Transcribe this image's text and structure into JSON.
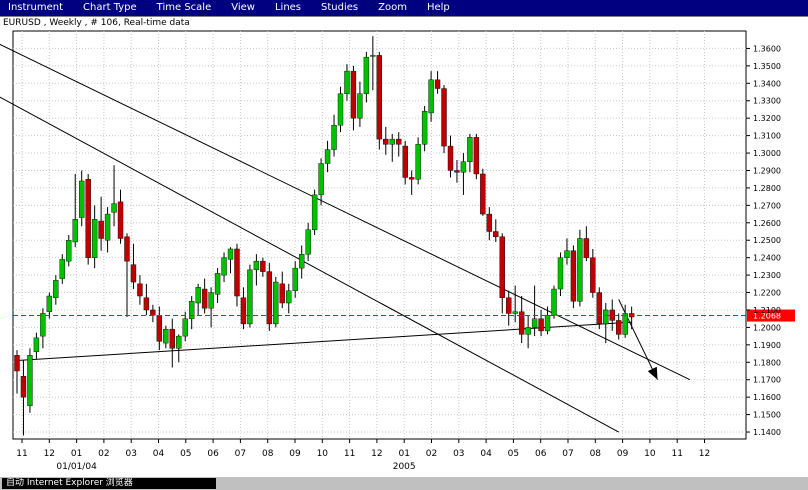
{
  "menu": {
    "items": [
      {
        "label": "Instrument"
      },
      {
        "label": "Chart Type"
      },
      {
        "label": "Time Scale"
      },
      {
        "label": "View"
      },
      {
        "label": "Lines"
      },
      {
        "label": "Studies"
      },
      {
        "label": "Zoom"
      },
      {
        "label": "Help"
      }
    ]
  },
  "chart_title": "EURUSD , Weekly , # 106, Real-time data",
  "taskbar": {
    "item_label": "自动 Internet Explorer 浏览器"
  },
  "colors": {
    "up_candle": "#00c000",
    "down_candle": "#c00000",
    "wick": "#000000",
    "grid": "#c8c8c8",
    "current_price_line": "#ff0000",
    "current_price_label_bg": "#ff0000",
    "current_price_label_text": "#ffffff",
    "trendline": "#000000",
    "menubar_bg": "#000080"
  },
  "chart_data": {
    "type": "candlestick",
    "title": "EURUSD , Weekly , # 106, Real-time data",
    "y_axis": {
      "ylim": [
        1.136,
        1.37
      ],
      "tick_labels": [
        "1.1400",
        "1.1500",
        "1.1600",
        "1.1700",
        "1.1800",
        "1.1900",
        "1.2000",
        "1.2100",
        "1.2200",
        "1.2300",
        "1.2400",
        "1.2500",
        "1.2600",
        "1.2700",
        "1.2800",
        "1.2900",
        "1.3000",
        "1.3100",
        "1.3200",
        "1.3300",
        "1.3400",
        "1.3500",
        "1.3600"
      ],
      "position": "right"
    },
    "x_axis": {
      "month_labels": [
        "11",
        "12",
        "01",
        "02",
        "03",
        "04",
        "05",
        "06",
        "07",
        "08",
        "09",
        "10",
        "11",
        "12",
        "01",
        "02",
        "03",
        "04",
        "05",
        "06",
        "07",
        "08",
        "09",
        "10",
        "11",
        "12"
      ],
      "year_labels": [
        "01/01/04",
        "2005"
      ]
    },
    "grid": true,
    "current_price": {
      "value": 1.2068,
      "label": "1.2068"
    },
    "candles": [
      {
        "o": 1.184,
        "h": 1.187,
        "l": 1.162,
        "c": 1.175
      },
      {
        "o": 1.172,
        "h": 1.181,
        "l": 1.138,
        "c": 1.16
      },
      {
        "o": 1.155,
        "h": 1.188,
        "l": 1.151,
        "c": 1.184
      },
      {
        "o": 1.186,
        "h": 1.197,
        "l": 1.182,
        "c": 1.194
      },
      {
        "o": 1.195,
        "h": 1.211,
        "l": 1.188,
        "c": 1.208
      },
      {
        "o": 1.209,
        "h": 1.22,
        "l": 1.205,
        "c": 1.218
      },
      {
        "o": 1.217,
        "h": 1.23,
        "l": 1.213,
        "c": 1.227
      },
      {
        "o": 1.228,
        "h": 1.242,
        "l": 1.225,
        "c": 1.239
      },
      {
        "o": 1.238,
        "h": 1.253,
        "l": 1.235,
        "c": 1.25
      },
      {
        "o": 1.249,
        "h": 1.288,
        "l": 1.246,
        "c": 1.262
      },
      {
        "o": 1.263,
        "h": 1.29,
        "l": 1.258,
        "c": 1.284
      },
      {
        "o": 1.285,
        "h": 1.288,
        "l": 1.236,
        "c": 1.24
      },
      {
        "o": 1.24,
        "h": 1.27,
        "l": 1.234,
        "c": 1.262
      },
      {
        "o": 1.261,
        "h": 1.275,
        "l": 1.244,
        "c": 1.251
      },
      {
        "o": 1.25,
        "h": 1.269,
        "l": 1.243,
        "c": 1.265
      },
      {
        "o": 1.266,
        "h": 1.293,
        "l": 1.258,
        "c": 1.271
      },
      {
        "o": 1.272,
        "h": 1.279,
        "l": 1.248,
        "c": 1.251
      },
      {
        "o": 1.252,
        "h": 1.254,
        "l": 1.206,
        "c": 1.238
      },
      {
        "o": 1.236,
        "h": 1.248,
        "l": 1.222,
        "c": 1.226
      },
      {
        "o": 1.225,
        "h": 1.23,
        "l": 1.213,
        "c": 1.218
      },
      {
        "o": 1.217,
        "h": 1.225,
        "l": 1.207,
        "c": 1.21
      },
      {
        "o": 1.21,
        "h": 1.213,
        "l": 1.203,
        "c": 1.207
      },
      {
        "o": 1.207,
        "h": 1.212,
        "l": 1.187,
        "c": 1.192
      },
      {
        "o": 1.191,
        "h": 1.201,
        "l": 1.188,
        "c": 1.199
      },
      {
        "o": 1.199,
        "h": 1.205,
        "l": 1.177,
        "c": 1.188
      },
      {
        "o": 1.188,
        "h": 1.196,
        "l": 1.18,
        "c": 1.195
      },
      {
        "o": 1.195,
        "h": 1.209,
        "l": 1.192,
        "c": 1.205
      },
      {
        "o": 1.205,
        "h": 1.218,
        "l": 1.199,
        "c": 1.215
      },
      {
        "o": 1.214,
        "h": 1.225,
        "l": 1.207,
        "c": 1.223
      },
      {
        "o": 1.222,
        "h": 1.228,
        "l": 1.208,
        "c": 1.211
      },
      {
        "o": 1.211,
        "h": 1.223,
        "l": 1.2,
        "c": 1.22
      },
      {
        "o": 1.219,
        "h": 1.234,
        "l": 1.214,
        "c": 1.231
      },
      {
        "o": 1.23,
        "h": 1.243,
        "l": 1.226,
        "c": 1.24
      },
      {
        "o": 1.239,
        "h": 1.246,
        "l": 1.231,
        "c": 1.245
      },
      {
        "o": 1.245,
        "h": 1.248,
        "l": 1.212,
        "c": 1.218
      },
      {
        "o": 1.217,
        "h": 1.223,
        "l": 1.199,
        "c": 1.202
      },
      {
        "o": 1.202,
        "h": 1.236,
        "l": 1.2,
        "c": 1.233
      },
      {
        "o": 1.233,
        "h": 1.242,
        "l": 1.224,
        "c": 1.238
      },
      {
        "o": 1.238,
        "h": 1.24,
        "l": 1.229,
        "c": 1.232
      },
      {
        "o": 1.232,
        "h": 1.237,
        "l": 1.198,
        "c": 1.202
      },
      {
        "o": 1.202,
        "h": 1.229,
        "l": 1.2,
        "c": 1.226
      },
      {
        "o": 1.225,
        "h": 1.232,
        "l": 1.211,
        "c": 1.214
      },
      {
        "o": 1.214,
        "h": 1.225,
        "l": 1.208,
        "c": 1.221
      },
      {
        "o": 1.221,
        "h": 1.238,
        "l": 1.217,
        "c": 1.234
      },
      {
        "o": 1.234,
        "h": 1.247,
        "l": 1.228,
        "c": 1.242
      },
      {
        "o": 1.242,
        "h": 1.26,
        "l": 1.238,
        "c": 1.256
      },
      {
        "o": 1.256,
        "h": 1.279,
        "l": 1.253,
        "c": 1.276
      },
      {
        "o": 1.276,
        "h": 1.297,
        "l": 1.27,
        "c": 1.294
      },
      {
        "o": 1.294,
        "h": 1.307,
        "l": 1.289,
        "c": 1.302
      },
      {
        "o": 1.302,
        "h": 1.322,
        "l": 1.298,
        "c": 1.316
      },
      {
        "o": 1.316,
        "h": 1.338,
        "l": 1.312,
        "c": 1.334
      },
      {
        "o": 1.334,
        "h": 1.351,
        "l": 1.33,
        "c": 1.347
      },
      {
        "o": 1.347,
        "h": 1.35,
        "l": 1.313,
        "c": 1.32
      },
      {
        "o": 1.32,
        "h": 1.341,
        "l": 1.315,
        "c": 1.334
      },
      {
        "o": 1.334,
        "h": 1.358,
        "l": 1.329,
        "c": 1.355
      },
      {
        "o": 1.356,
        "h": 1.367,
        "l": 1.336,
        "c": 1.356
      },
      {
        "o": 1.356,
        "h": 1.358,
        "l": 1.302,
        "c": 1.308
      },
      {
        "o": 1.308,
        "h": 1.315,
        "l": 1.299,
        "c": 1.305
      },
      {
        "o": 1.305,
        "h": 1.311,
        "l": 1.295,
        "c": 1.308
      },
      {
        "o": 1.308,
        "h": 1.312,
        "l": 1.298,
        "c": 1.305
      },
      {
        "o": 1.304,
        "h": 1.307,
        "l": 1.282,
        "c": 1.286
      },
      {
        "o": 1.286,
        "h": 1.29,
        "l": 1.276,
        "c": 1.285
      },
      {
        "o": 1.285,
        "h": 1.309,
        "l": 1.282,
        "c": 1.305
      },
      {
        "o": 1.305,
        "h": 1.327,
        "l": 1.301,
        "c": 1.324
      },
      {
        "o": 1.323,
        "h": 1.347,
        "l": 1.318,
        "c": 1.342
      },
      {
        "o": 1.342,
        "h": 1.347,
        "l": 1.334,
        "c": 1.337
      },
      {
        "o": 1.337,
        "h": 1.339,
        "l": 1.3,
        "c": 1.304
      },
      {
        "o": 1.304,
        "h": 1.31,
        "l": 1.286,
        "c": 1.29
      },
      {
        "o": 1.29,
        "h": 1.296,
        "l": 1.283,
        "c": 1.289
      },
      {
        "o": 1.289,
        "h": 1.3,
        "l": 1.276,
        "c": 1.295
      },
      {
        "o": 1.295,
        "h": 1.311,
        "l": 1.289,
        "c": 1.309
      },
      {
        "o": 1.309,
        "h": 1.311,
        "l": 1.285,
        "c": 1.288
      },
      {
        "o": 1.288,
        "h": 1.291,
        "l": 1.264,
        "c": 1.265
      },
      {
        "o": 1.265,
        "h": 1.269,
        "l": 1.25,
        "c": 1.255
      },
      {
        "o": 1.255,
        "h": 1.262,
        "l": 1.249,
        "c": 1.252
      },
      {
        "o": 1.252,
        "h": 1.254,
        "l": 1.208,
        "c": 1.217
      },
      {
        "o": 1.217,
        "h": 1.221,
        "l": 1.201,
        "c": 1.208
      },
      {
        "o": 1.208,
        "h": 1.224,
        "l": 1.203,
        "c": 1.209
      },
      {
        "o": 1.209,
        "h": 1.218,
        "l": 1.191,
        "c": 1.196
      },
      {
        "o": 1.196,
        "h": 1.207,
        "l": 1.188,
        "c": 1.2
      },
      {
        "o": 1.2,
        "h": 1.224,
        "l": 1.195,
        "c": 1.205
      },
      {
        "o": 1.205,
        "h": 1.21,
        "l": 1.195,
        "c": 1.198
      },
      {
        "o": 1.198,
        "h": 1.212,
        "l": 1.196,
        "c": 1.207
      },
      {
        "o": 1.207,
        "h": 1.224,
        "l": 1.205,
        "c": 1.222
      },
      {
        "o": 1.222,
        "h": 1.243,
        "l": 1.218,
        "c": 1.24
      },
      {
        "o": 1.24,
        "h": 1.251,
        "l": 1.236,
        "c": 1.244
      },
      {
        "o": 1.244,
        "h": 1.247,
        "l": 1.211,
        "c": 1.215
      },
      {
        "o": 1.215,
        "h": 1.256,
        "l": 1.212,
        "c": 1.251
      },
      {
        "o": 1.251,
        "h": 1.258,
        "l": 1.238,
        "c": 1.24
      },
      {
        "o": 1.24,
        "h": 1.245,
        "l": 1.217,
        "c": 1.22
      },
      {
        "o": 1.22,
        "h": 1.223,
        "l": 1.199,
        "c": 1.202
      },
      {
        "o": 1.202,
        "h": 1.214,
        "l": 1.191,
        "c": 1.21
      },
      {
        "o": 1.21,
        "h": 1.216,
        "l": 1.198,
        "c": 1.204
      },
      {
        "o": 1.204,
        "h": 1.208,
        "l": 1.193,
        "c": 1.196
      },
      {
        "o": 1.196,
        "h": 1.213,
        "l": 1.194,
        "c": 1.208
      },
      {
        "o": 1.208,
        "h": 1.212,
        "l": 1.199,
        "c": 1.206
      }
    ],
    "trendlines": [
      {
        "from": {
          "bar": 0,
          "price": 1.181
        },
        "to": {
          "bar": 95,
          "price": 1.203
        }
      },
      {
        "from": {
          "bar": -27,
          "price": 1.381
        },
        "to": {
          "bar": 93,
          "price": 1.14
        }
      },
      {
        "from": {
          "bar": -13,
          "price": 1.381
        },
        "to": {
          "bar": 104,
          "price": 1.17
        }
      },
      {
        "from": {
          "bar": 93,
          "price": 1.216
        },
        "to": {
          "bar": 99,
          "price": 1.17
        },
        "arrow": true
      }
    ]
  }
}
